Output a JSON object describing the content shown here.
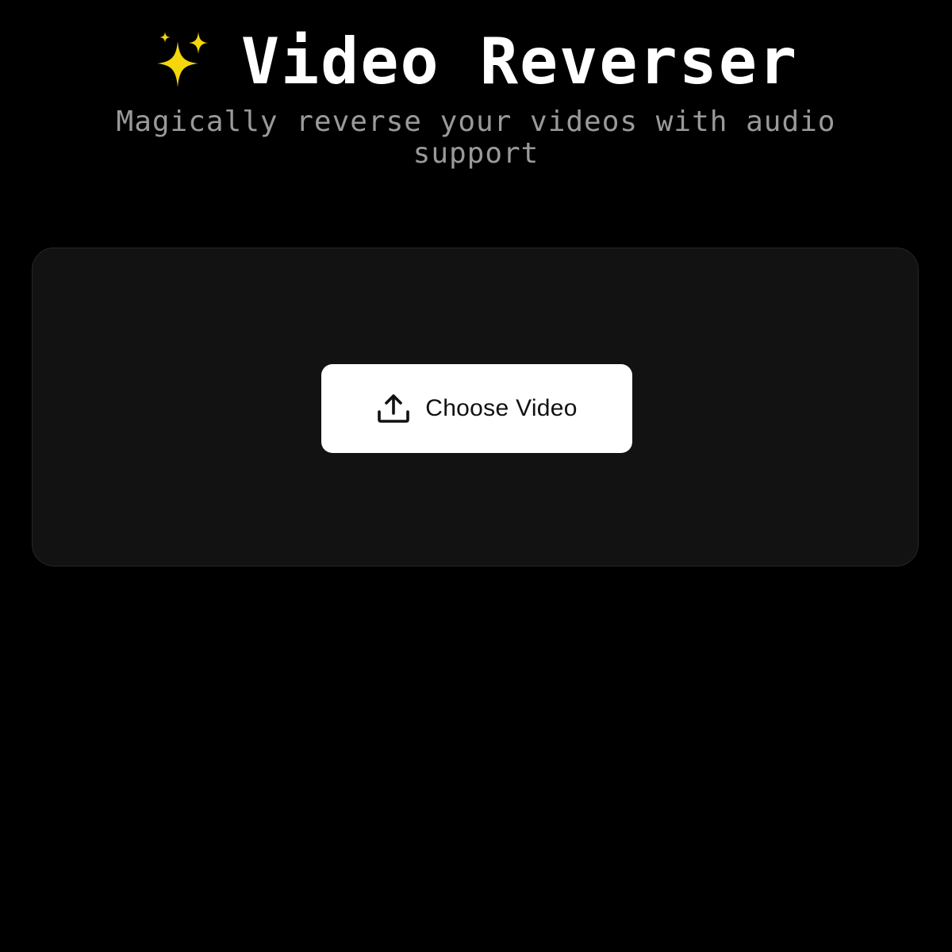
{
  "header": {
    "title_icon": "sparkles-icon",
    "title": "Video Reverser",
    "subtitle": "Magically reverse your videos with audio support"
  },
  "upload": {
    "button_icon": "upload-icon",
    "button_label": "Choose Video"
  },
  "colors": {
    "background": "#000000",
    "card": "#121212",
    "card_border": "#262626",
    "button": "#ffffff",
    "subtitle": "#9a9a9a",
    "sparkle": "#f5d60a"
  }
}
